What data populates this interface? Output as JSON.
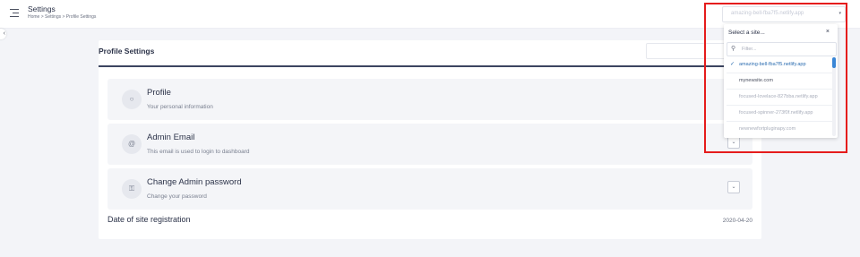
{
  "header": {
    "title": "Settings",
    "breadcrumb": "Home > Settings > Profile Settings",
    "site_select_value": "amazing-bell-fba7f5.netlify.app"
  },
  "main": {
    "title": "Profile Settings",
    "rows": [
      {
        "icon": "user-icon",
        "title": "Profile",
        "subtitle": "Your personal information"
      },
      {
        "icon": "at-sign-icon",
        "title": "Admin Email",
        "subtitle": "This email is used to login to dashboard"
      },
      {
        "icon": "key-icon",
        "title": "Change Admin password",
        "subtitle": "Change your password"
      }
    ],
    "registration_label": "Date of site registration",
    "registration_date": "2020-04-20"
  },
  "dropdown": {
    "title": "Select a site...",
    "close_label": "×",
    "filter_placeholder": "Filter...",
    "items": [
      {
        "label": "amazing-bell-fba7f5.netlify.app",
        "selected": true
      },
      {
        "label": "mynewsite.com",
        "selected": false
      },
      {
        "label": "focused-lovelace-827bba.netlify.app",
        "selected": false
      },
      {
        "label": "focused-spinner-273f0f.netlify.app",
        "selected": false
      },
      {
        "label": "newnewfortpluginapy.com",
        "selected": false
      }
    ]
  },
  "colors": {
    "accent": "#2b6cb0",
    "highlight": "#e51c1c"
  }
}
